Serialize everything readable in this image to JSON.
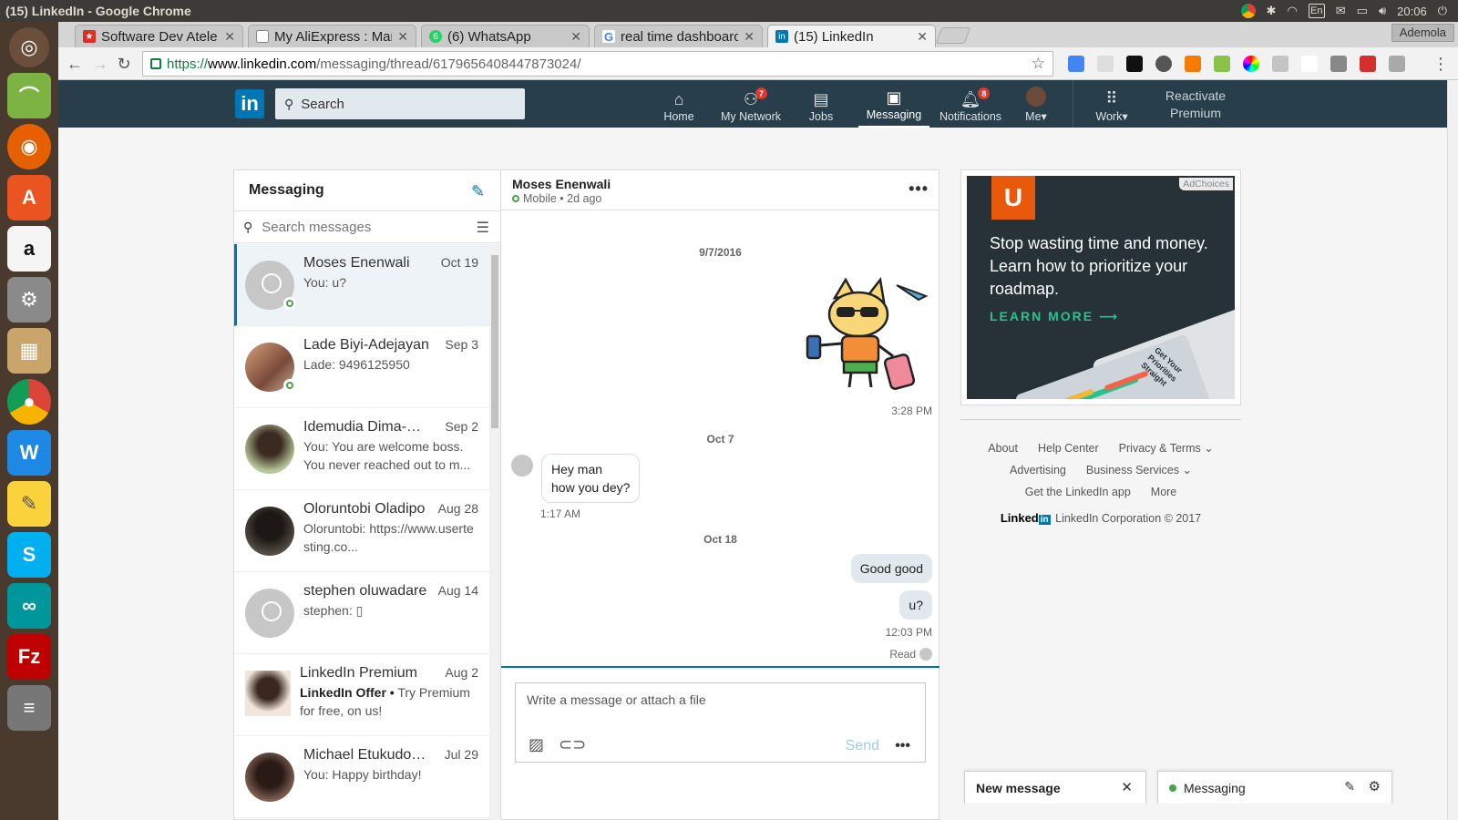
{
  "os": {
    "window_title": "(15) LinkedIn - Google Chrome",
    "keyboard_layout": "En",
    "clock": "20:06"
  },
  "chrome": {
    "tabs": [
      {
        "title": "Software Dev Atele",
        "favicon_color": "#d93025"
      },
      {
        "title": "My AliExpress : Mar",
        "favicon_color": "#e0e0e0"
      },
      {
        "title": "(6) WhatsApp",
        "favicon_color": "#25d366"
      },
      {
        "title": "real time dashboarc",
        "favicon_color": "#4285f4"
      },
      {
        "title": "(15) LinkedIn",
        "favicon_color": "#0077b5"
      }
    ],
    "profile_name": "Ademola",
    "url_scheme": "https://",
    "url_host": "www.linkedin.com",
    "url_path": "/messaging/thread/6179656408447873024/"
  },
  "linkedin_nav": {
    "logo": "in",
    "search_placeholder": "Search",
    "items": [
      {
        "label": "Home",
        "icon": "home-icon"
      },
      {
        "label": "My Network",
        "icon": "network-icon",
        "badge": "7"
      },
      {
        "label": "Jobs",
        "icon": "briefcase-icon"
      },
      {
        "label": "Messaging",
        "icon": "messaging-icon",
        "active": true
      },
      {
        "label": "Notifications",
        "icon": "bell-icon",
        "badge": "8"
      },
      {
        "label": "Me",
        "icon": "avatar"
      },
      {
        "label": "Work",
        "icon": "grid-icon"
      }
    ],
    "premium_line1": "Reactivate",
    "premium_line2": "Premium"
  },
  "messaging": {
    "title": "Messaging",
    "search_placeholder": "Search messages",
    "conversations": [
      {
        "name": "Moses Enenwali",
        "date": "Oct 19",
        "snippet": "You: u?",
        "online": true,
        "selected": true,
        "avatar": "default"
      },
      {
        "name": "Lade Biyi-Adejayan",
        "date": "Sep 3",
        "snippet": "Lade: 9496125950",
        "online": true,
        "avatar": "#9a6a58"
      },
      {
        "name": "Idemudia Dima-Ok...",
        "date": "Sep 2",
        "snippet": "You: You are welcome boss. You never reached out to m...",
        "avatar": "#5a4a3a"
      },
      {
        "name": "Oloruntobi Oladipo",
        "date": "Aug 28",
        "snippet": "Oloruntobi: https://www.usertesting.co...",
        "avatar": "#2d2622"
      },
      {
        "name": "stephen oluwadare",
        "date": "Aug 14",
        "snippet": "stephen: ▯",
        "avatar": "default"
      },
      {
        "name": "LinkedIn Premium",
        "date": "Aug 2",
        "snippet_bold": "LinkedIn Offer •",
        "snippet": "Try Premium for free, on us!",
        "avatar": "#b58a6f"
      },
      {
        "name": "Michael Etukudoh ...",
        "date": "Jul 29",
        "snippet": "You: Happy birthday!",
        "avatar": "#3a2a26"
      }
    ]
  },
  "thread": {
    "name": "Moses Enenwali",
    "status": "Mobile • 2d ago",
    "date1": "9/7/2016",
    "time1": "3:28 PM",
    "date2": "Oct 7",
    "msg_in_line1": "Hey man",
    "msg_in_line2": "how you dey?",
    "time2": "1:17 AM",
    "date3": "Oct 18",
    "msg_out1": "Good good",
    "msg_out2": "u?",
    "time3": "12:03 PM",
    "read": "Read",
    "compose_placeholder": "Write a message or attach a file",
    "send": "Send"
  },
  "ad": {
    "adchoices": "AdChoices",
    "headline": "Stop wasting time and money. Learn how to prioritize your roadmap.",
    "cta": "LEARN MORE ⟶",
    "device_text": "Get Your Priorities Straight"
  },
  "footer": {
    "links": [
      "About",
      "Help Center",
      "Privacy & Terms ⌄",
      "Advertising",
      "Business Services ⌄",
      "Get the LinkedIn app",
      "More"
    ],
    "brand_word": "Linked",
    "brand_in": "in",
    "copyright": "LinkedIn Corporation © 2017"
  },
  "popups": {
    "new_message": "New message",
    "messaging": "Messaging"
  }
}
